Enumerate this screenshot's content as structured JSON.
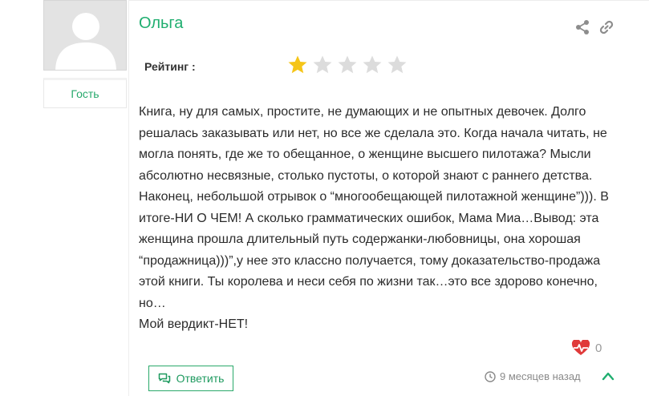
{
  "author": {
    "name": "Ольга",
    "role": "Гость"
  },
  "rating": {
    "label": "Рейтинг :",
    "value": 1,
    "max": 5,
    "filled_color": "#f5c518",
    "empty_color": "#dcdcdc"
  },
  "comment": {
    "text": "Книга, ну для самых, простите, не думающих и не опытных девочек. Долго решалась заказывать или нет, но все же сделала это. Когда начала читать, не могла понять, где же то обещанное, о женщине высшего пилотажа? Мысли абсолютно несвязные, столько пустоты, о которой знают с раннего детства. Наконец, небольшой отрывок о “многообещающей пилотажной женщине”))). В итоге-НИ О ЧЕМ! А сколько грамматических ошибок, Мама Миа…Вывод: эта женщина прошла длительный путь содержанки-любовницы, она хорошая “продажница)))”,у нее это классно получается, тому доказательство-продажа этой книги. Ты королева и неси себя по жизни так…это все здорово конечно, но…\nМой вердикт-НЕТ!"
  },
  "actions": {
    "like_count": "0",
    "reply_label": "Ответить",
    "time_ago": "9 месяцев назад"
  },
  "icons": {
    "share": "share-icon",
    "link": "link-icon",
    "like": "heart-pulse-icon",
    "reply": "chat-bubbles-icon",
    "clock": "clock-icon",
    "collapse": "chevron-up-icon"
  },
  "colors": {
    "accent": "#1fae6f",
    "like": "#e03a3a"
  }
}
